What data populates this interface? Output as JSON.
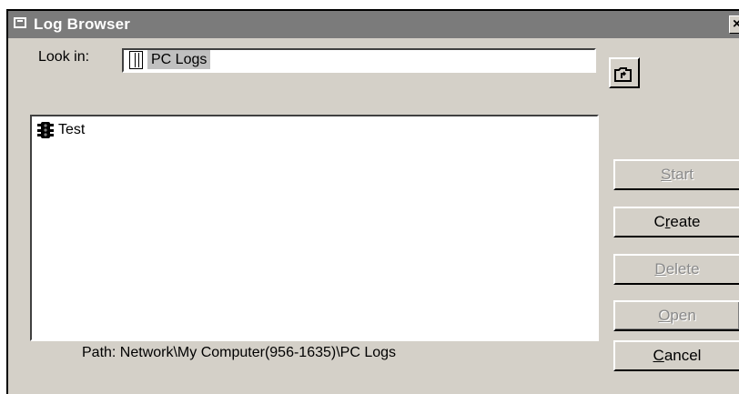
{
  "window": {
    "title": "Log Browser",
    "close_glyph": "×"
  },
  "lookin": {
    "label": "Look in:",
    "value": "PC Logs",
    "icon": "log-folder-icon"
  },
  "up_button": {
    "icon": "up-one-level-icon"
  },
  "list": {
    "items": [
      {
        "label": "Test",
        "icon": "traffic-light-icon"
      }
    ]
  },
  "buttons": {
    "start": {
      "u": "S",
      "rest": "tart",
      "disabled": true
    },
    "create": {
      "pre": "C",
      "u": "r",
      "rest": "eate",
      "disabled": false
    },
    "delete": {
      "u": "D",
      "rest": "elete",
      "disabled": true
    },
    "open": {
      "u": "O",
      "rest": "pen",
      "disabled": true
    },
    "cancel": {
      "u": "C",
      "rest": "ancel",
      "disabled": false
    }
  },
  "path": {
    "text": "Path:  Network\\My Computer(956-1635)\\PC Logs"
  }
}
